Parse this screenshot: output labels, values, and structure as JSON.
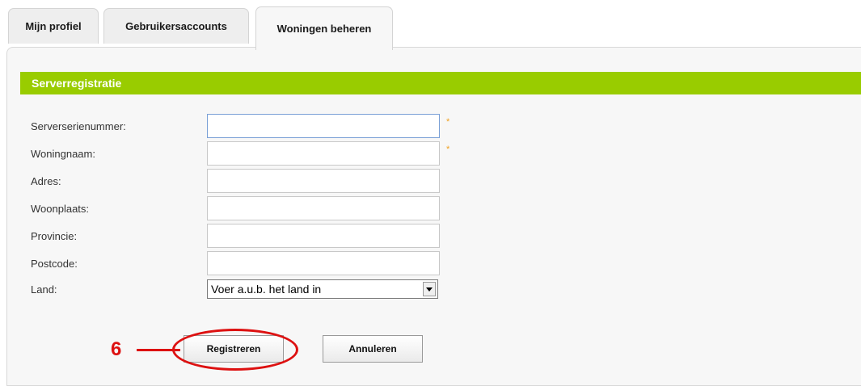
{
  "tabs": [
    {
      "label": "Mijn profiel",
      "active": false
    },
    {
      "label": "Gebruikersaccounts",
      "active": false
    },
    {
      "label": "Woningen beheren",
      "active": true
    }
  ],
  "section": {
    "title": "Serverregistratie"
  },
  "form": {
    "fields": [
      {
        "label": "Serverserienummer:",
        "value": "",
        "required": true
      },
      {
        "label": "Woningnaam:",
        "value": "",
        "required": true
      },
      {
        "label": "Adres:",
        "value": "",
        "required": false
      },
      {
        "label": "Woonplaats:",
        "value": "",
        "required": false
      },
      {
        "label": "Provincie:",
        "value": "",
        "required": false
      },
      {
        "label": "Postcode:",
        "value": "",
        "required": false
      }
    ],
    "country": {
      "label": "Land:",
      "selected": "Voer a.u.b. het land in"
    },
    "required_marker": "*"
  },
  "buttons": {
    "register": "Registreren",
    "cancel": "Annuleren"
  },
  "annotation": {
    "step_number": "6"
  },
  "colors": {
    "accent": "#99cc00",
    "callout": "#dd1111",
    "required": "#f0a020"
  }
}
